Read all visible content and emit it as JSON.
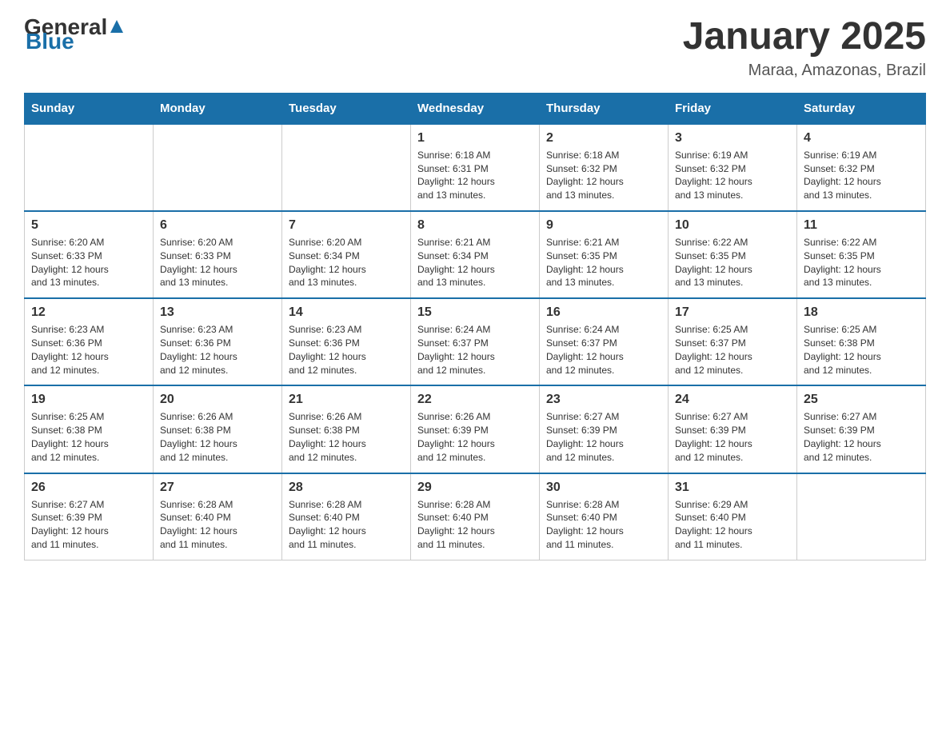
{
  "header": {
    "logo_general": "General",
    "logo_blue": "Blue",
    "month_title": "January 2025",
    "location": "Maraa, Amazonas, Brazil"
  },
  "weekdays": [
    "Sunday",
    "Monday",
    "Tuesday",
    "Wednesday",
    "Thursday",
    "Friday",
    "Saturday"
  ],
  "weeks": [
    [
      {
        "day": "",
        "info": ""
      },
      {
        "day": "",
        "info": ""
      },
      {
        "day": "",
        "info": ""
      },
      {
        "day": "1",
        "info": "Sunrise: 6:18 AM\nSunset: 6:31 PM\nDaylight: 12 hours\nand 13 minutes."
      },
      {
        "day": "2",
        "info": "Sunrise: 6:18 AM\nSunset: 6:32 PM\nDaylight: 12 hours\nand 13 minutes."
      },
      {
        "day": "3",
        "info": "Sunrise: 6:19 AM\nSunset: 6:32 PM\nDaylight: 12 hours\nand 13 minutes."
      },
      {
        "day": "4",
        "info": "Sunrise: 6:19 AM\nSunset: 6:32 PM\nDaylight: 12 hours\nand 13 minutes."
      }
    ],
    [
      {
        "day": "5",
        "info": "Sunrise: 6:20 AM\nSunset: 6:33 PM\nDaylight: 12 hours\nand 13 minutes."
      },
      {
        "day": "6",
        "info": "Sunrise: 6:20 AM\nSunset: 6:33 PM\nDaylight: 12 hours\nand 13 minutes."
      },
      {
        "day": "7",
        "info": "Sunrise: 6:20 AM\nSunset: 6:34 PM\nDaylight: 12 hours\nand 13 minutes."
      },
      {
        "day": "8",
        "info": "Sunrise: 6:21 AM\nSunset: 6:34 PM\nDaylight: 12 hours\nand 13 minutes."
      },
      {
        "day": "9",
        "info": "Sunrise: 6:21 AM\nSunset: 6:35 PM\nDaylight: 12 hours\nand 13 minutes."
      },
      {
        "day": "10",
        "info": "Sunrise: 6:22 AM\nSunset: 6:35 PM\nDaylight: 12 hours\nand 13 minutes."
      },
      {
        "day": "11",
        "info": "Sunrise: 6:22 AM\nSunset: 6:35 PM\nDaylight: 12 hours\nand 13 minutes."
      }
    ],
    [
      {
        "day": "12",
        "info": "Sunrise: 6:23 AM\nSunset: 6:36 PM\nDaylight: 12 hours\nand 12 minutes."
      },
      {
        "day": "13",
        "info": "Sunrise: 6:23 AM\nSunset: 6:36 PM\nDaylight: 12 hours\nand 12 minutes."
      },
      {
        "day": "14",
        "info": "Sunrise: 6:23 AM\nSunset: 6:36 PM\nDaylight: 12 hours\nand 12 minutes."
      },
      {
        "day": "15",
        "info": "Sunrise: 6:24 AM\nSunset: 6:37 PM\nDaylight: 12 hours\nand 12 minutes."
      },
      {
        "day": "16",
        "info": "Sunrise: 6:24 AM\nSunset: 6:37 PM\nDaylight: 12 hours\nand 12 minutes."
      },
      {
        "day": "17",
        "info": "Sunrise: 6:25 AM\nSunset: 6:37 PM\nDaylight: 12 hours\nand 12 minutes."
      },
      {
        "day": "18",
        "info": "Sunrise: 6:25 AM\nSunset: 6:38 PM\nDaylight: 12 hours\nand 12 minutes."
      }
    ],
    [
      {
        "day": "19",
        "info": "Sunrise: 6:25 AM\nSunset: 6:38 PM\nDaylight: 12 hours\nand 12 minutes."
      },
      {
        "day": "20",
        "info": "Sunrise: 6:26 AM\nSunset: 6:38 PM\nDaylight: 12 hours\nand 12 minutes."
      },
      {
        "day": "21",
        "info": "Sunrise: 6:26 AM\nSunset: 6:38 PM\nDaylight: 12 hours\nand 12 minutes."
      },
      {
        "day": "22",
        "info": "Sunrise: 6:26 AM\nSunset: 6:39 PM\nDaylight: 12 hours\nand 12 minutes."
      },
      {
        "day": "23",
        "info": "Sunrise: 6:27 AM\nSunset: 6:39 PM\nDaylight: 12 hours\nand 12 minutes."
      },
      {
        "day": "24",
        "info": "Sunrise: 6:27 AM\nSunset: 6:39 PM\nDaylight: 12 hours\nand 12 minutes."
      },
      {
        "day": "25",
        "info": "Sunrise: 6:27 AM\nSunset: 6:39 PM\nDaylight: 12 hours\nand 12 minutes."
      }
    ],
    [
      {
        "day": "26",
        "info": "Sunrise: 6:27 AM\nSunset: 6:39 PM\nDaylight: 12 hours\nand 11 minutes."
      },
      {
        "day": "27",
        "info": "Sunrise: 6:28 AM\nSunset: 6:40 PM\nDaylight: 12 hours\nand 11 minutes."
      },
      {
        "day": "28",
        "info": "Sunrise: 6:28 AM\nSunset: 6:40 PM\nDaylight: 12 hours\nand 11 minutes."
      },
      {
        "day": "29",
        "info": "Sunrise: 6:28 AM\nSunset: 6:40 PM\nDaylight: 12 hours\nand 11 minutes."
      },
      {
        "day": "30",
        "info": "Sunrise: 6:28 AM\nSunset: 6:40 PM\nDaylight: 12 hours\nand 11 minutes."
      },
      {
        "day": "31",
        "info": "Sunrise: 6:29 AM\nSunset: 6:40 PM\nDaylight: 12 hours\nand 11 minutes."
      },
      {
        "day": "",
        "info": ""
      }
    ]
  ]
}
